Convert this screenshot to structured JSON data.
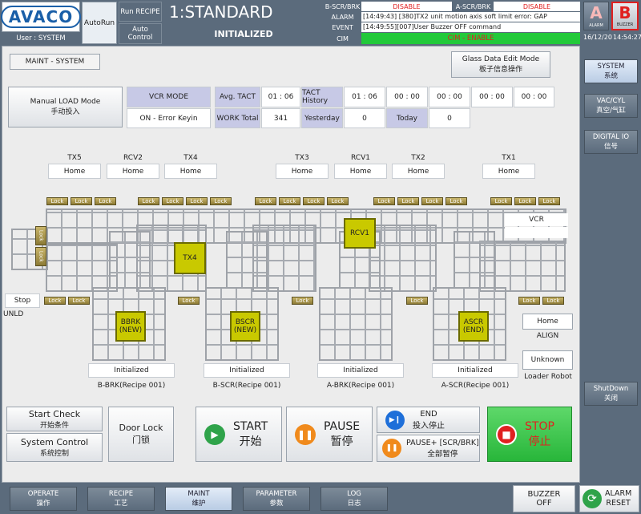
{
  "header": {
    "logo": "AVACO",
    "user": "User : SYSTEM",
    "mode": "AutoRun",
    "run_recipe_label": "Run RECIPE",
    "auto_control_label": "Auto Control",
    "recipe_name": "1:STANDARD",
    "state": "INITIALIZED",
    "b_scr_brk_label": "B-SCR/BRK",
    "b_scr_brk_value": "DISABLE",
    "a_scr_brk_label": "A-SCR/BRK",
    "a_scr_brk_value": "DISABLE",
    "alarm_label": "ALARM",
    "alarm_text": "[14:49:43] [380]TX2 unit motion axis soft limit error: GAP",
    "event_label": "EVENT",
    "event_text": "[14:49:55][007]User Buzzer OFF command",
    "cim_label": "CIM",
    "cim_value": "CIM - ENABLE",
    "alarm_icon_letter": "A",
    "alarm_icon_label": "ALARM",
    "buzzer_icon_letter": "B",
    "buzzer_icon_label": "BUZZER",
    "date": "16/12/20",
    "time": "14:54:27"
  },
  "main": {
    "maint_title": "MAINT - SYSTEM",
    "glass_edit": [
      "Glass Data Edit Mode",
      "板子信息操作"
    ],
    "manual_load": [
      "Manual LOAD Mode",
      "手动投入"
    ],
    "vcr_mode_label": "VCR MODE",
    "vcr_mode_value": "ON - Error Keyin",
    "avg_tact_label": "Avg. TACT",
    "avg_tact_value": "01 : 06",
    "tact_history_label": "TACT History",
    "tact_history": [
      "01 : 06",
      "00 : 00",
      "00 : 00",
      "00 : 00",
      "00 : 00"
    ],
    "work_total_label": "WORK Total",
    "work_total_value": "341",
    "yesterday_label": "Yesterday",
    "yesterday_value": "0",
    "today_label": "Today",
    "today_value": "0"
  },
  "units": [
    {
      "name": "TX5",
      "state": "Home"
    },
    {
      "name": "RCV2",
      "state": "Home"
    },
    {
      "name": "TX4",
      "state": "Home"
    },
    {
      "name": "TX3",
      "state": "Home"
    },
    {
      "name": "RCV1",
      "state": "Home"
    },
    {
      "name": "TX2",
      "state": "Home"
    },
    {
      "name": "TX1",
      "state": "Home"
    }
  ],
  "lock_label": "Lock",
  "vcr_label": "VCR",
  "unld": {
    "state": "Stop",
    "label": "UNLD"
  },
  "align": {
    "state": "Home",
    "label": "ALIGN"
  },
  "loader_robot": {
    "state": "Unknown",
    "label": "Loader Robot"
  },
  "stages": [
    {
      "name": "BBRK",
      "sub": "(NEW)",
      "state": "Initialized",
      "label": "B-BRK(Recipe 001)"
    },
    {
      "name": "BSCR",
      "sub": "(NEW)",
      "state": "Initialized",
      "label": "B-SCR(Recipe 001)"
    },
    {
      "name": "",
      "sub": "",
      "state": "Initialized",
      "label": "A-BRK(Recipe 001)"
    },
    {
      "name": "ASCR",
      "sub": "(END)",
      "state": "Initialized",
      "label": "A-SCR(Recipe 001)"
    }
  ],
  "carriers": [
    {
      "name": "TX4"
    },
    {
      "name": "RCV1"
    }
  ],
  "controls": {
    "start_check": [
      "Start Check",
      "开始条件"
    ],
    "system_control": [
      "System Control",
      "系统控制"
    ],
    "door_lock": [
      "Door Lock",
      "门锁"
    ],
    "start": [
      "START",
      "开始"
    ],
    "pause": [
      "PAUSE",
      "暂停"
    ],
    "end": [
      "END",
      "投入停止"
    ],
    "pause_plus": [
      "PAUSE+ [SCR/BRK]",
      "全部暂停"
    ],
    "stop": [
      "STOP",
      "停止"
    ]
  },
  "side": {
    "system": [
      "SYSTEM",
      "系统"
    ],
    "vac_cyl": [
      "VAC/CYL",
      "真空/气缸"
    ],
    "digital_io": [
      "DIGITAL IO",
      "信号"
    ],
    "shutdown": [
      "ShutDown",
      "关闭"
    ]
  },
  "nav": [
    [
      "OPERATE",
      "操作"
    ],
    [
      "RECIPE",
      "工艺"
    ],
    [
      "MAINT",
      "维护"
    ],
    [
      "PARAMETER",
      "参数"
    ],
    [
      "LOG",
      "日志"
    ]
  ],
  "buzzer_off": [
    "BUZZER",
    "OFF"
  ],
  "alarm_reset": [
    "ALARM",
    "RESET"
  ],
  "colors": {
    "stop": "#e02020",
    "start_icon": "#2fa34a",
    "pause_icon": "#f08a1c",
    "end_icon": "#1e6fd9",
    "cim_ok": "#22c93a",
    "disable": "#e02020"
  }
}
